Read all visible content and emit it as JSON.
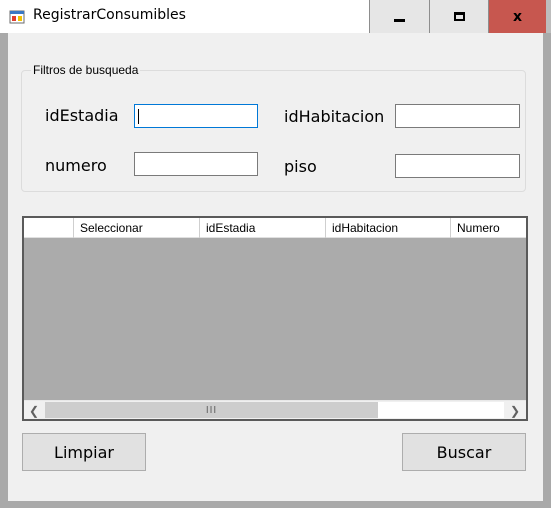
{
  "window": {
    "title": "RegistrarConsumibles",
    "icon": "winforms-app-icon",
    "controls": {
      "minimize": "minimize-icon",
      "maximize": "maximize-icon",
      "close_label": "x"
    }
  },
  "filters": {
    "legend": "Filtros de busqueda",
    "idEstadia": {
      "label": "idEstadia",
      "value": ""
    },
    "idHabitacion": {
      "label": "idHabitacion",
      "value": ""
    },
    "numero": {
      "label": "numero",
      "value": ""
    },
    "piso": {
      "label": "piso",
      "value": ""
    }
  },
  "grid": {
    "columns": [
      "",
      "Seleccionar",
      "idEstadia",
      "idHabitacion",
      "Numero"
    ],
    "rows": [],
    "scroll_thumb_glyph": "III"
  },
  "buttons": {
    "limpiar": "Limpiar",
    "buscar": "Buscar"
  }
}
